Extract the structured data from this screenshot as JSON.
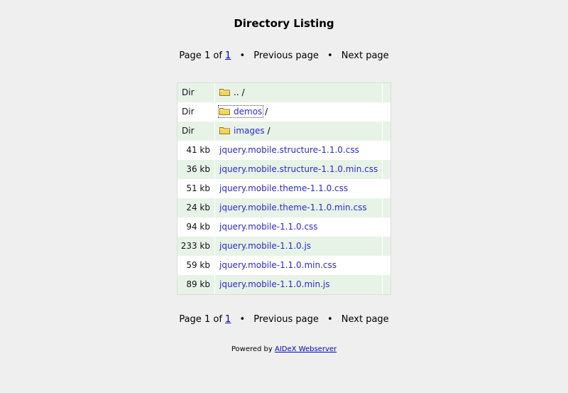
{
  "title": "Directory Listing",
  "pager": {
    "page_label": "Page",
    "current": "1",
    "of_label": "of",
    "total": "1",
    "bullet": "•",
    "prev_label": "Previous page",
    "next_label": "Next page"
  },
  "rows": [
    {
      "size": "Dir",
      "name": "..",
      "suffix": "/",
      "is_dir": true
    },
    {
      "size": "Dir",
      "name": "demos",
      "suffix": "/",
      "is_dir": true
    },
    {
      "size": "Dir",
      "name": "images",
      "suffix": "/",
      "is_dir": true
    },
    {
      "size": "41 kb",
      "name": "jquery.mobile.structure-1.1.0.css"
    },
    {
      "size": "36 kb",
      "name": "jquery.mobile.structure-1.1.0.min.css"
    },
    {
      "size": "51 kb",
      "name": "jquery.mobile.theme-1.1.0.css"
    },
    {
      "size": "24 kb",
      "name": "jquery.mobile.theme-1.1.0.min.css"
    },
    {
      "size": "94 kb",
      "name": "jquery.mobile-1.1.0.css"
    },
    {
      "size": "233 kb",
      "name": "jquery.mobile-1.1.0.js"
    },
    {
      "size": "59 kb",
      "name": "jquery.mobile-1.1.0.min.css"
    },
    {
      "size": "89 kb",
      "name": "jquery.mobile-1.1.0.min.js"
    }
  ],
  "footer": {
    "prefix": "Powered by",
    "link": "AIDeX Webserver"
  },
  "colors": {
    "background": "#efefef",
    "row_alt": "#e8f3e8",
    "link": "#2a2ad0",
    "folder": "#f3d35a"
  },
  "icons": {
    "folder": "folder-icon"
  }
}
